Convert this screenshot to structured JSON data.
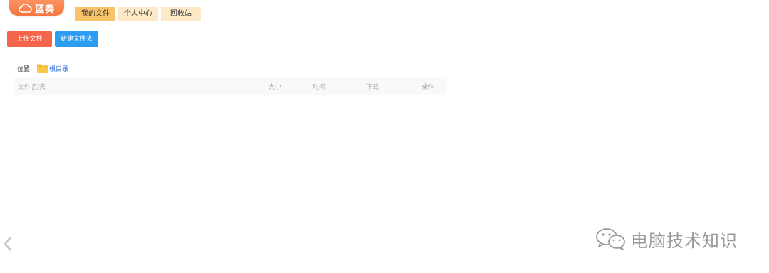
{
  "header": {
    "logo_text": "蓝奏",
    "tabs": [
      {
        "label": "我的文件",
        "active": true
      },
      {
        "label": "个人中心",
        "active": false
      },
      {
        "label": "回收站",
        "active": false
      }
    ]
  },
  "toolbar": {
    "upload_label": "上传文件",
    "new_folder_label": "新建文件夹"
  },
  "location": {
    "label": "位置:",
    "root": "根目录"
  },
  "file_table": {
    "columns": [
      "文件名/夹",
      "大小",
      "时间",
      "下载",
      "操作"
    ]
  },
  "watermark": {
    "text": "电脑技术知识",
    "icon": "wechat-icon"
  },
  "colors": {
    "accent_orange": "#f4763f",
    "tab_active": "#f9c36a",
    "tab_inactive": "#fde8c8",
    "upload_button": "#f56549",
    "new_folder_button": "#2d9cf3",
    "link_blue": "#2a6fd8",
    "folder_yellow": "#f5b82e"
  }
}
